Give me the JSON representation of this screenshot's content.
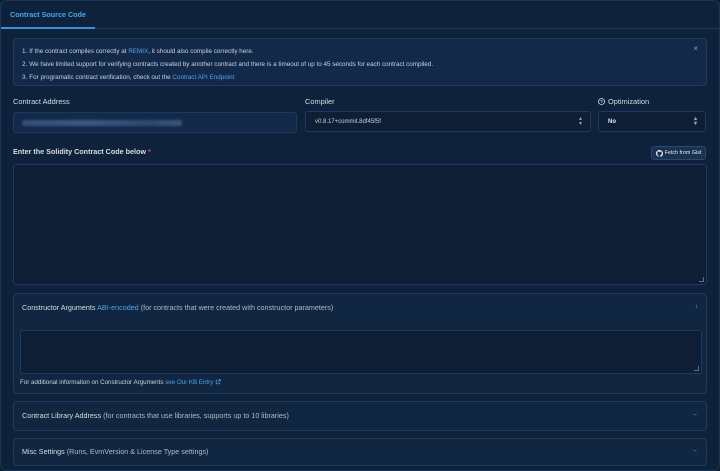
{
  "tabs": {
    "active": "Contract Source Code"
  },
  "alert": {
    "items": [
      {
        "num": "1.",
        "before": "If the contract compiles correctly at ",
        "link": "REMIX",
        "after": ", it should also compile correctly here."
      },
      {
        "num": "2.",
        "before": "We have limited support for verifying contracts created by another contract and there is a timeout of up to 45 seconds for each contract compiled.",
        "link": "",
        "after": ""
      },
      {
        "num": "3.",
        "before": "For programatic contract verification, check out the ",
        "link": "Contract API Endpoint",
        "after": ""
      }
    ],
    "close": "×"
  },
  "form": {
    "address_label": "Contract Address",
    "compiler_label": "Compiler",
    "compiler_value": "v0.8.17+commit.8df45f5f",
    "optimization_label": "Optimization",
    "optimization_value": "No",
    "code_label": "Enter the Solidity Contract Code below",
    "required_mark": "*",
    "fetch_label": "Fetch from Gist"
  },
  "constructor": {
    "title": "Constructor Arguments",
    "link": "ABI-encoded",
    "desc": "(for contracts that were created with constructor parameters)",
    "note_before": "For additional information on Constructor Arguments ",
    "note_link": "see Our KB Entry"
  },
  "library": {
    "title": "Contract Library Address",
    "desc": "(for contracts that use libraries, supports up to 10 libraries)"
  },
  "misc": {
    "title": "Misc Settings",
    "desc": "(Runs, EvmVersion & License Type settings)"
  },
  "colors": {
    "accent": "#4fa3e8",
    "background": "#0f223b",
    "required": "#e0535a"
  }
}
